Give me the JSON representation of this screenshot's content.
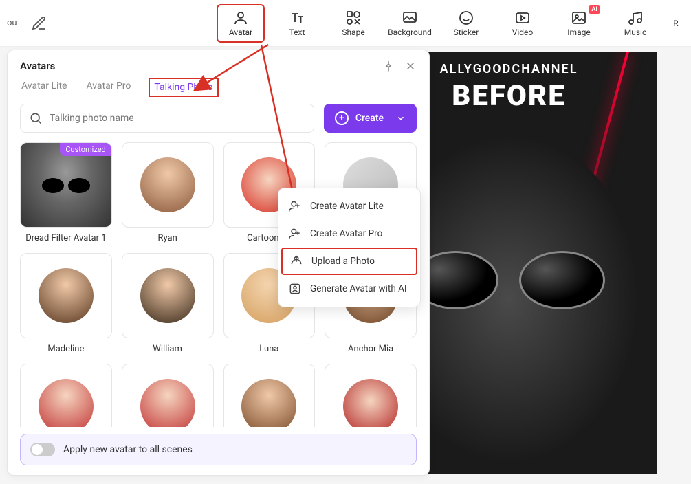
{
  "toolbar": {
    "left_label": "ou",
    "items": [
      {
        "label": "Avatar",
        "active": true
      },
      {
        "label": "Text"
      },
      {
        "label": "Shape"
      },
      {
        "label": "Background"
      },
      {
        "label": "Sticker"
      },
      {
        "label": "Video"
      },
      {
        "label": "Image",
        "badge": "AI"
      },
      {
        "label": "Music"
      },
      {
        "label": "R"
      }
    ]
  },
  "panel": {
    "title": "Avatars",
    "tabs": [
      {
        "label": "Avatar Lite"
      },
      {
        "label": "Avatar Pro"
      },
      {
        "label": "Talking Photo",
        "active": true
      }
    ],
    "search_placeholder": "Talking photo name",
    "create_label": "Create",
    "avatars": [
      {
        "name": "Dread Filter Avatar 1",
        "badge": "Customized"
      },
      {
        "name": "Ryan"
      },
      {
        "name": "Cartoon Sa"
      },
      {
        "name": ""
      },
      {
        "name": "Madeline"
      },
      {
        "name": "William"
      },
      {
        "name": "Luna"
      },
      {
        "name": "Anchor Mia"
      },
      {
        "name": ""
      },
      {
        "name": ""
      },
      {
        "name": ""
      },
      {
        "name": ""
      }
    ],
    "apply_label": "Apply new avatar to all scenes"
  },
  "dropdown": {
    "items": [
      {
        "label": "Create Avatar Lite"
      },
      {
        "label": "Create Avatar Pro"
      },
      {
        "label": "Upload a Photo",
        "highlighted": true
      },
      {
        "label": "Generate Avatar with AI"
      }
    ]
  },
  "canvas": {
    "line1": "ALLYGOODCHANNEL",
    "line2": "BEFORE"
  }
}
